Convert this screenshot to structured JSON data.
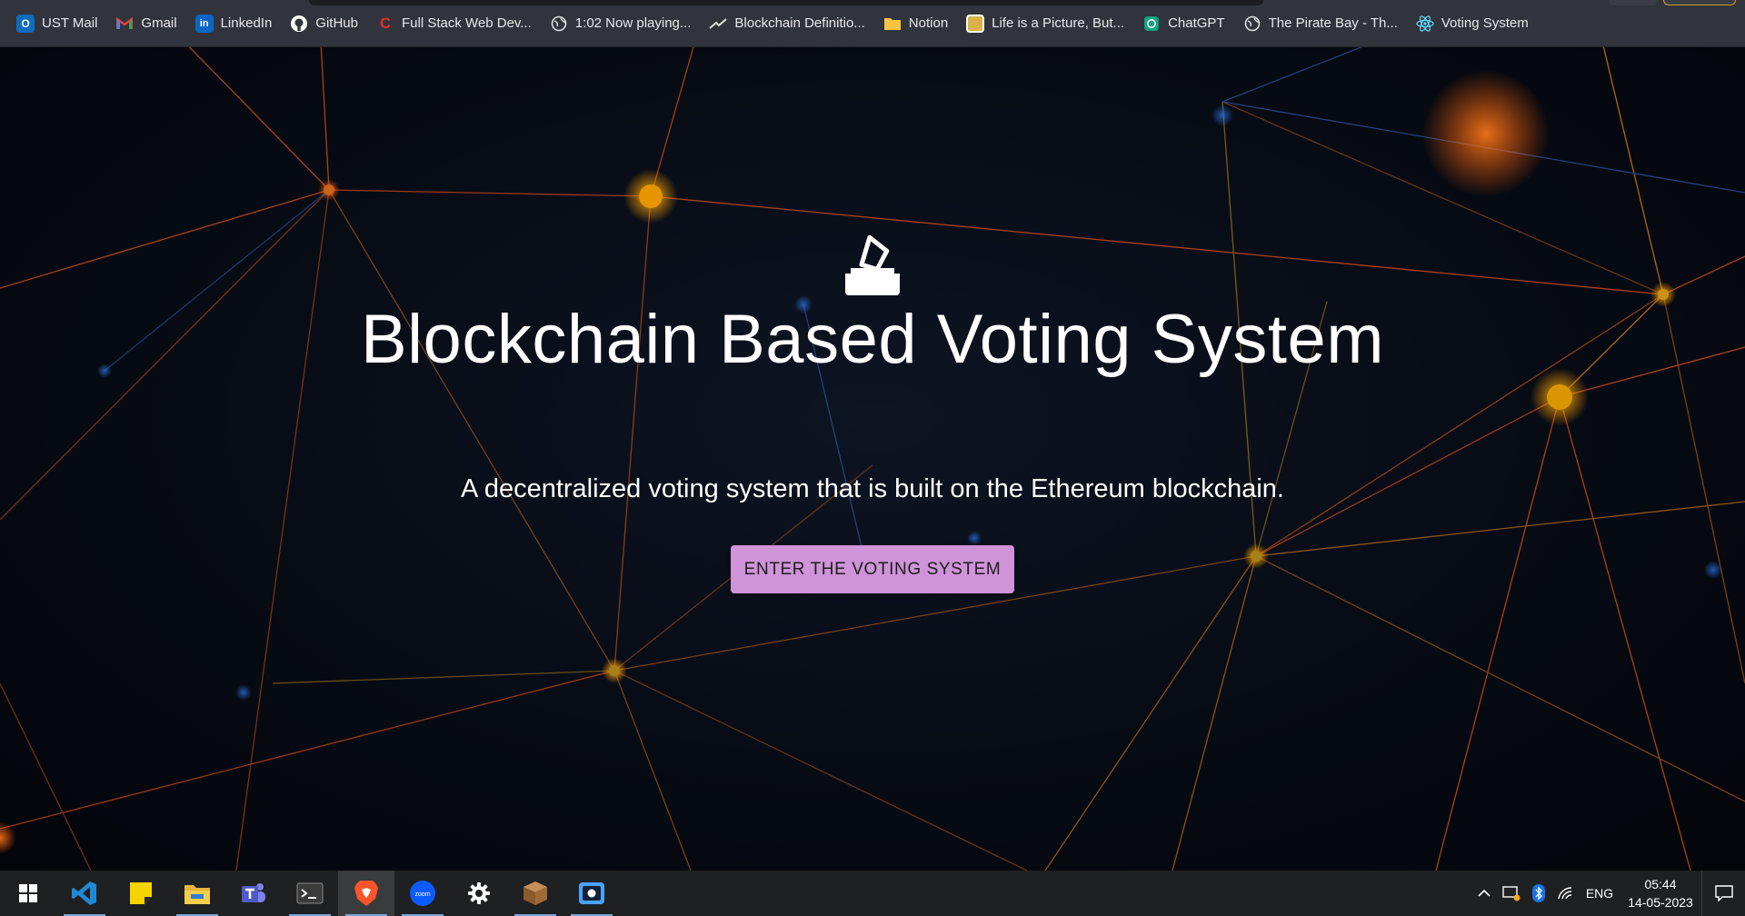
{
  "bookmarks": [
    {
      "label": "UST Mail",
      "icon": "outlook-icon",
      "color": "#0f6cbd"
    },
    {
      "label": "Gmail",
      "icon": "gmail-icon",
      "color": "#ea4335"
    },
    {
      "label": "LinkedIn",
      "icon": "linkedin-icon",
      "color": "#0a66c2"
    },
    {
      "label": "GitHub",
      "icon": "github-icon",
      "color": "#ffffff"
    },
    {
      "label": "Full Stack Web Dev...",
      "icon": "codecademy-icon",
      "color": "#e0312b"
    },
    {
      "label": "1:02 Now playing...",
      "icon": "globe-icon",
      "color": "#cccccc"
    },
    {
      "label": "Blockchain Definitio...",
      "icon": "investopedia-icon",
      "color": "#cccccc"
    },
    {
      "label": "Notion",
      "icon": "folder-icon",
      "color": "#f4c542"
    },
    {
      "label": "Life is a Picture, But...",
      "icon": "pixel-art-icon",
      "color": "#d9b24a"
    },
    {
      "label": "ChatGPT",
      "icon": "chatgpt-icon",
      "color": "#10a37f"
    },
    {
      "label": "The Pirate Bay - Th...",
      "icon": "globe-icon",
      "color": "#cccccc"
    },
    {
      "label": "Voting System",
      "icon": "react-icon",
      "color": "#61dafb"
    }
  ],
  "hero": {
    "icon": "ballot-box-icon",
    "title": "Blockchain Based Voting System",
    "subtitle": "A decentralized voting system that is built on the Ethereum blockchain.",
    "button_label": "ENTER THE VOTING SYSTEM",
    "button_color": "#ce93d8"
  },
  "taskbar": {
    "apps": [
      {
        "name": "windows-start-icon"
      },
      {
        "name": "vscode-icon"
      },
      {
        "name": "sticky-notes-icon"
      },
      {
        "name": "file-explorer-icon"
      },
      {
        "name": "teams-icon"
      },
      {
        "name": "terminal-icon"
      },
      {
        "name": "brave-browser-icon"
      },
      {
        "name": "zoom-icon"
      },
      {
        "name": "settings-icon"
      },
      {
        "name": "minecraft-icon"
      },
      {
        "name": "screen-recorder-icon"
      }
    ],
    "zoom_label": "zoom",
    "tray": {
      "language": "ENG",
      "time": "05:44",
      "date": "14-05-2023"
    }
  }
}
